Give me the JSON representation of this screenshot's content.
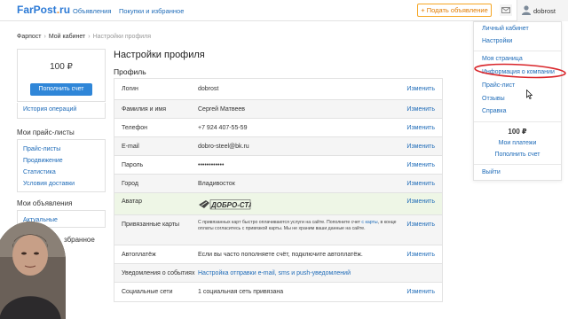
{
  "header": {
    "logo_main": "FarPost",
    "logo_dot": ".",
    "logo_tld": "ru",
    "nav": [
      "Объявления",
      "Покупки и избранное"
    ],
    "post_ad": "+ Подать объявление",
    "username": "dobrost"
  },
  "breadcrumb": [
    "Фарпост",
    "Мой кабинет",
    "Настройки профиля"
  ],
  "sidebar": {
    "balance": "100 ₽",
    "pay_button": "Пополнить счет",
    "history": "История операций",
    "pricelists_title": "Мои прайс-листы",
    "pricelists": [
      "Прайс-листы",
      "Продвижение",
      "Статистика",
      "Условия доставки"
    ],
    "ads_title": "Мои объявления",
    "ads": [
      "Актуальные"
    ],
    "partial_title": "збранное"
  },
  "main": {
    "title": "Настройки профиля",
    "section": "Профиль",
    "edit_label": "Изменить",
    "rows": [
      {
        "label": "Логин",
        "value": "dobrost",
        "edit": true
      },
      {
        "label": "Фамилия и имя",
        "value": "Сергей Матвеев",
        "edit": true
      },
      {
        "label": "Телефон",
        "value": "+7 924 407-55-59",
        "edit": true
      },
      {
        "label": "E-mail",
        "value": "dobro-steel@bk.ru",
        "edit": true
      },
      {
        "label": "Пароль",
        "value": "••••••••••••",
        "edit": true
      },
      {
        "label": "Город",
        "value": "Владивосток",
        "edit": true
      },
      {
        "label": "Аватар",
        "value": "ДОБРО-СТАЛЬ",
        "edit": true
      },
      {
        "label": "Привязанные карты",
        "value": "С привязанных карт быстро оплачиваются услуги на сайте. Пополните счет с карты, в конце оплаты согласитесь с привязкой карты. Мы не храним ваши данные на сайте.",
        "link_text": "с карты",
        "edit": true
      },
      {
        "label": "Автоплатёж",
        "value": "Если вы часто пополняете счёт, подключите автоплатёж.",
        "edit": true
      },
      {
        "label": "Уведомления о событиях",
        "value": "Настройка отправки e-mail, sms и push-уведомлений",
        "edit": false
      },
      {
        "label": "Социальные сети",
        "value": "1 социальная сеть привязана",
        "edit": true
      }
    ]
  },
  "dropdown": {
    "items_top": [
      "Личный кабинет",
      "Настройки"
    ],
    "items_mid": [
      "Моя страница",
      "Информация о компании",
      "Прайс-лист",
      "Отзывы",
      "Справка"
    ],
    "balance": "100 ₽",
    "payments": "Мои платежи",
    "topup": "Пополнить счет",
    "logout": "Выйти"
  },
  "colors": {
    "link": "#1e6bb8",
    "accent_orange": "#f5a623",
    "pay_button": "#2f86d8",
    "annotation_red": "#d9252a",
    "avatar_row_bg": "#eef6e6"
  }
}
